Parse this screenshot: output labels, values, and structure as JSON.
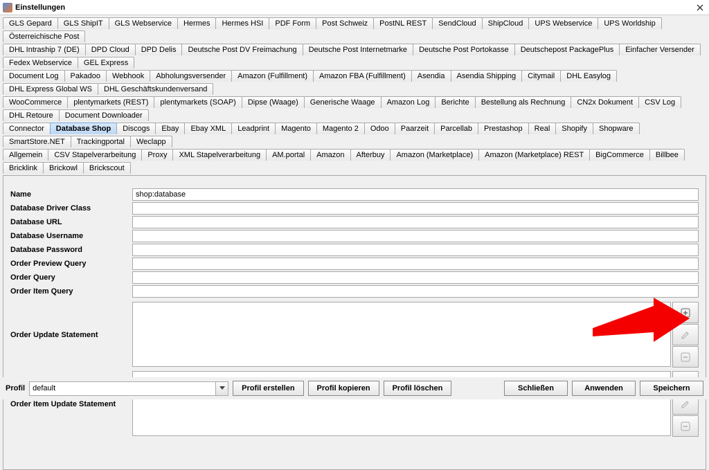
{
  "window": {
    "title": "Einstellungen"
  },
  "tabs": {
    "row1": [
      "GLS Gepard",
      "GLS ShipIT",
      "GLS Webservice",
      "Hermes",
      "Hermes HSI",
      "PDF Form",
      "Post Schweiz",
      "PostNL REST",
      "SendCloud",
      "ShipCloud",
      "UPS Webservice",
      "UPS Worldship",
      "Österreichische Post"
    ],
    "row2": [
      "DHL Intraship 7 (DE)",
      "DPD Cloud",
      "DPD Delis",
      "Deutsche Post DV Freimachung",
      "Deutsche Post Internetmarke",
      "Deutsche Post Portokasse",
      "Deutschepost PackagePlus",
      "Einfacher Versender",
      "Fedex Webservice",
      "GEL Express"
    ],
    "row3": [
      "Document Log",
      "Pakadoo",
      "Webhook",
      "Abholungsversender",
      "Amazon (Fulfillment)",
      "Amazon FBA (Fulfillment)",
      "Asendia",
      "Asendia Shipping",
      "Citymail",
      "DHL Easylog",
      "DHL Express Global WS",
      "DHL Geschäftskundenversand"
    ],
    "row4": [
      "WooCommerce",
      "plentymarkets (REST)",
      "plentymarkets (SOAP)",
      "Dipse (Waage)",
      "Generische Waage",
      "Amazon Log",
      "Berichte",
      "Bestellung als Rechnung",
      "CN2x Dokument",
      "CSV Log",
      "DHL Retoure",
      "Document Downloader"
    ],
    "row5": [
      "Connector",
      "Database Shop",
      "Discogs",
      "Ebay",
      "Ebay XML",
      "Leadprint",
      "Magento",
      "Magento 2",
      "Odoo",
      "Paarzeit",
      "Parcellab",
      "Prestashop",
      "Real",
      "Shopify",
      "Shopware",
      "SmartStore.NET",
      "Trackingportal",
      "Weclapp"
    ],
    "row6": [
      "Allgemein",
      "CSV Stapelverarbeitung",
      "Proxy",
      "XML Stapelverarbeitung",
      "AM.portal",
      "Amazon",
      "Afterbuy",
      "Amazon (Marketplace)",
      "Amazon (Marketplace) REST",
      "BigCommerce",
      "Billbee",
      "Bricklink",
      "Brickowl",
      "Brickscout"
    ],
    "active": "Database Shop"
  },
  "form": {
    "labels": {
      "name": "Name",
      "driver": "Database Driver Class",
      "url": "Database URL",
      "user": "Database Username",
      "pass": "Database Password",
      "preview": "Order Preview Query",
      "orderq": "Order Query",
      "itemq": "Order Item Query",
      "upd": "Order Update Statement",
      "itemupd": "Order Item Update Statement"
    },
    "values": {
      "name": "shop:database",
      "driver": "",
      "url": "",
      "user": "",
      "pass": "",
      "preview": "",
      "orderq": "",
      "itemq": "",
      "upd": "",
      "itemupd": ""
    }
  },
  "footer": {
    "profile_label": "Profil",
    "profile_value": "default",
    "btn_create": "Profil erstellen",
    "btn_copy": "Profil kopieren",
    "btn_delete": "Profil löschen",
    "btn_close": "Schließen",
    "btn_apply": "Anwenden",
    "btn_save": "Speichern"
  }
}
